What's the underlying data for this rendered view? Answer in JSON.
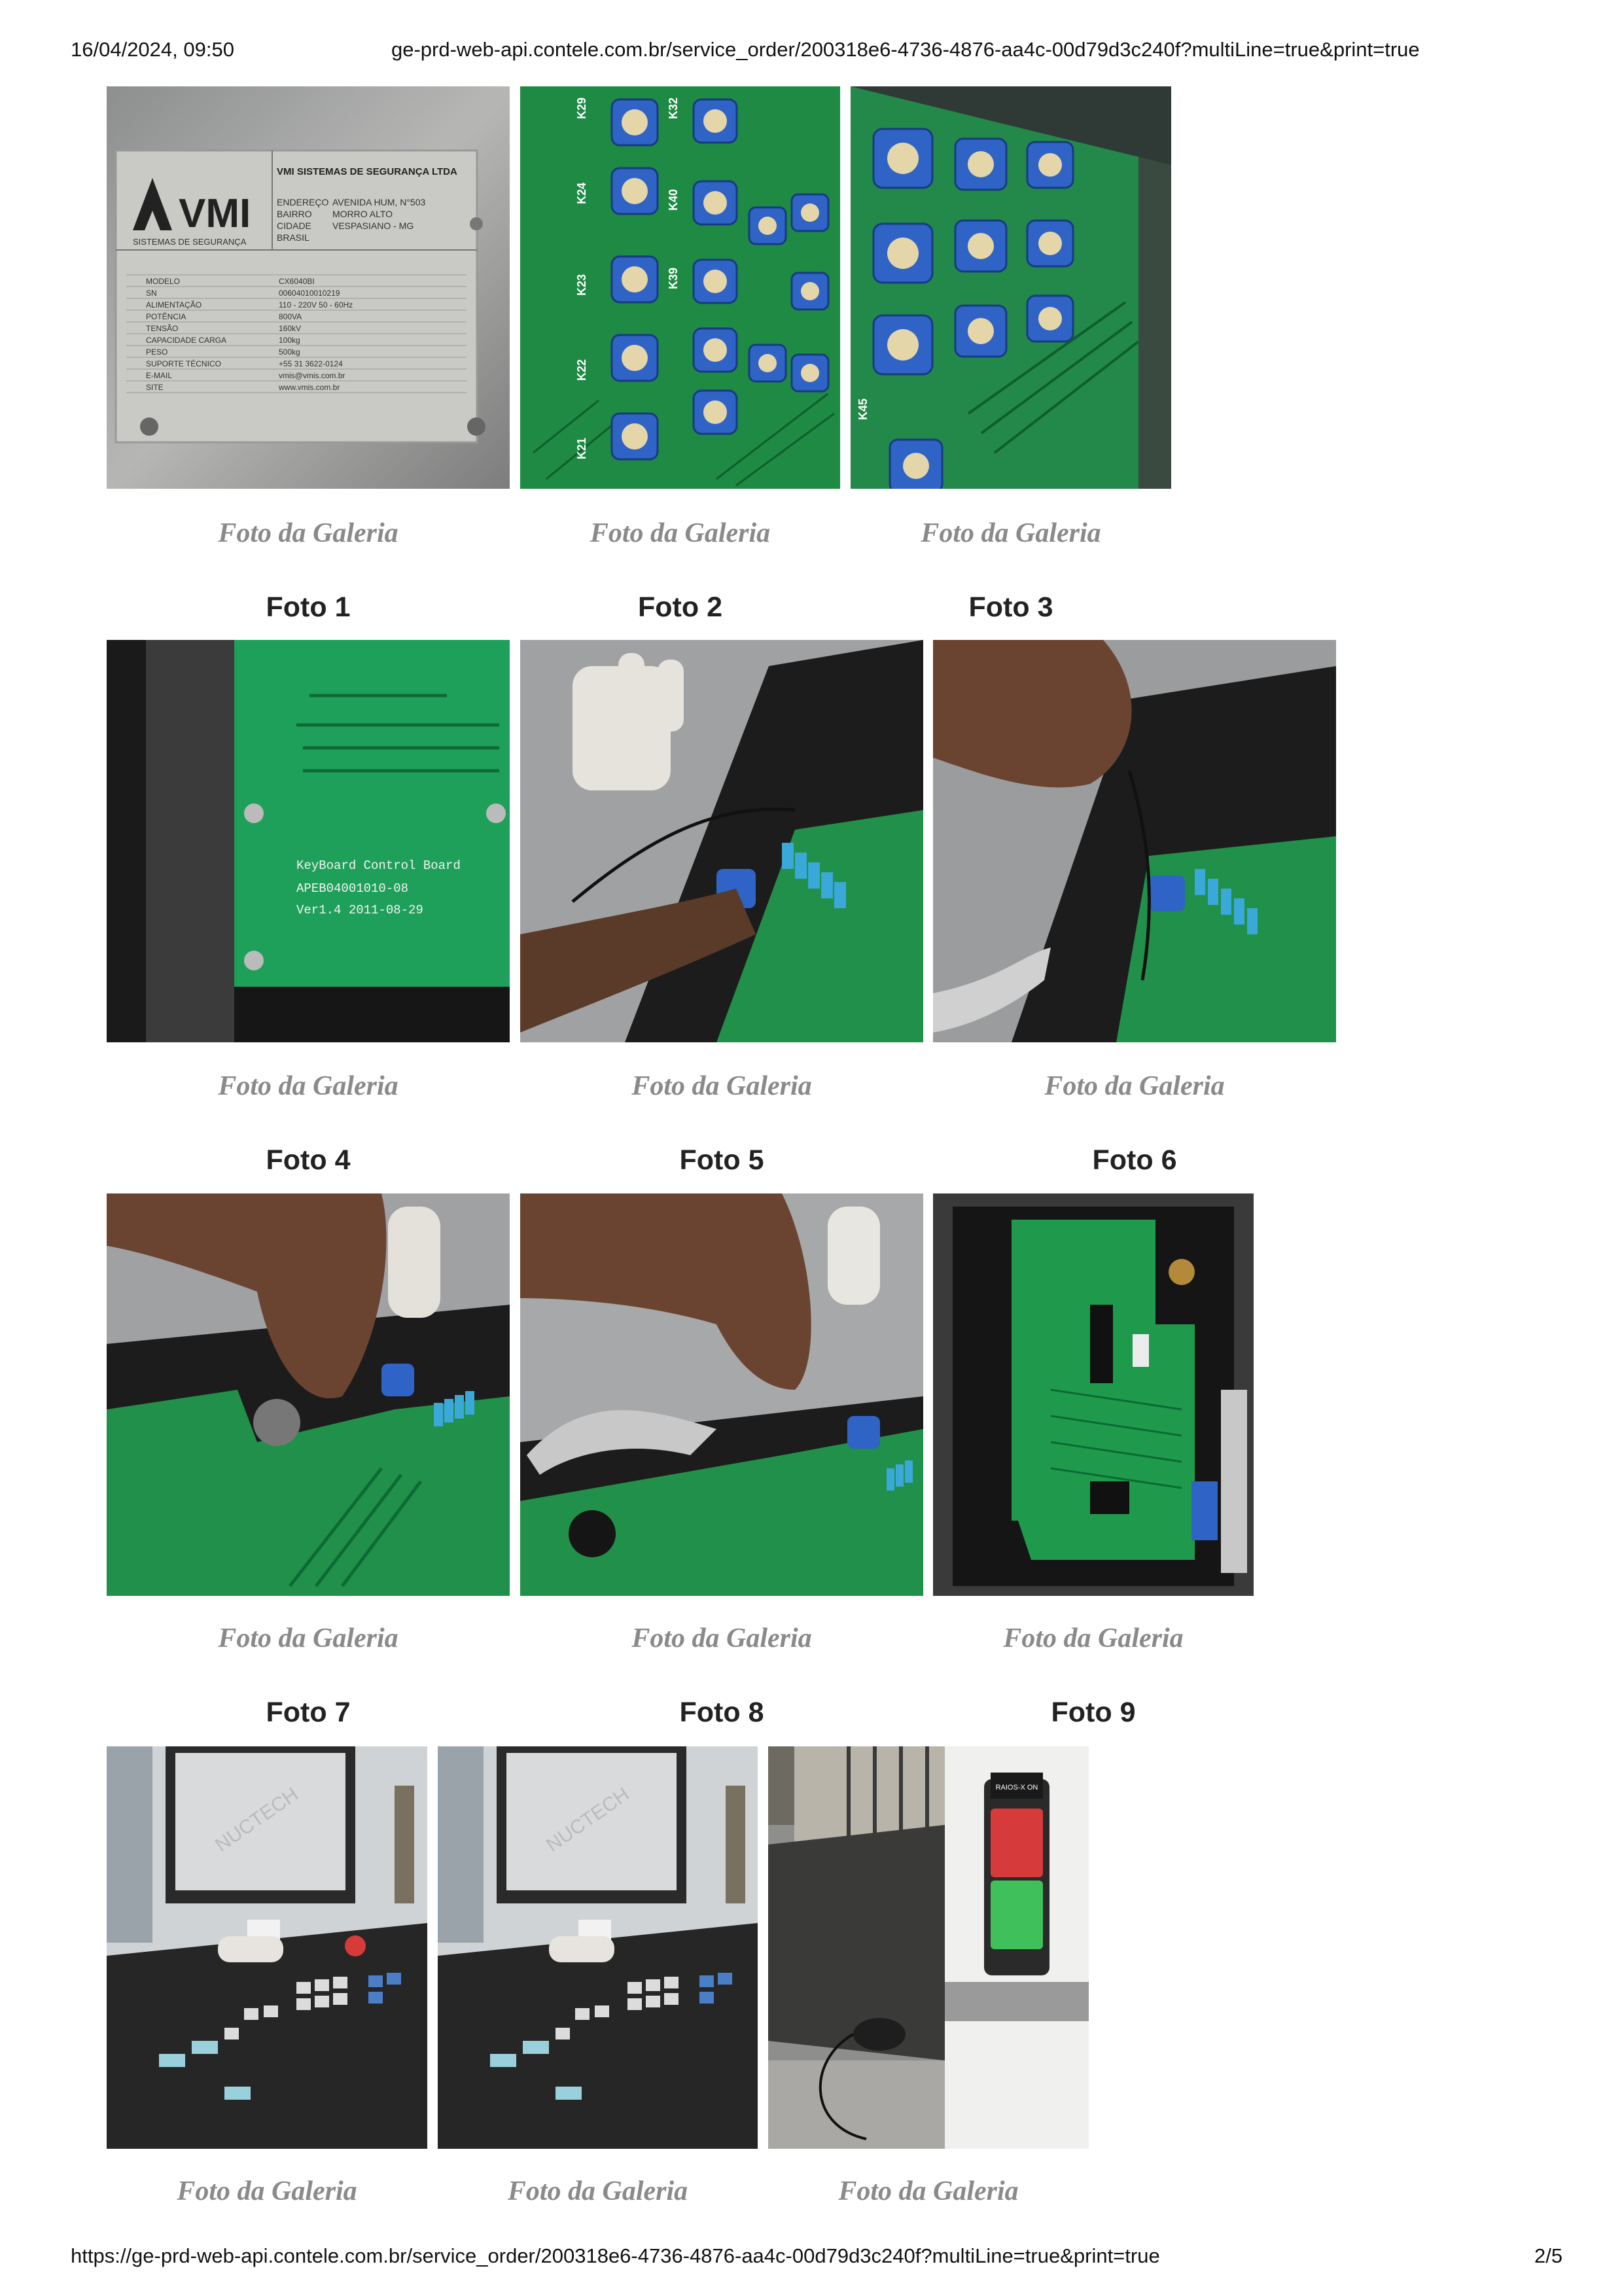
{
  "header": {
    "datetime": "16/04/2024, 09:50",
    "url": "ge-prd-web-api.contele.com.br/service_order/200318e6-4736-4876-aa4c-00d79d3c240f?multiLine=true&print=true"
  },
  "footer": {
    "url": "https://ge-prd-web-api.contele.com.br/service_order/200318e6-4736-4876-aa4c-00d79d3c240f?multiLine=true&print=true",
    "page": "2/5"
  },
  "rows": [
    {
      "captions": [
        "Foto da Galeria",
        "Foto da Galeria",
        "Foto da Galeria"
      ],
      "labels": [
        "Foto 1",
        "Foto 2",
        "Foto 3"
      ],
      "plate": {
        "company": "VMI SISTEMAS DE SEGURANÇA LTDA",
        "logo": "VMI",
        "tagline": "SISTEMAS DE SEGURANÇA",
        "address_labels": [
          "ENDEREÇO",
          "BAIRRO",
          "CIDADE"
        ],
        "address_values": [
          "AVENIDA HUM, N°503",
          "MORRO ALTO",
          "VESPASIANO - MG"
        ],
        "country": "BRASIL",
        "spec_labels": [
          "MODELO",
          "SN",
          "ALIMENTAÇÃO",
          "POTÊNCIA",
          "TENSÃO",
          "CAPACIDADE CARGA",
          "PESO",
          "SUPORTE TÉCNICO",
          "E-MAIL",
          "SITE"
        ],
        "spec_values": [
          "CX6040BI",
          "00604010010219",
          "110 - 220V   50 - 60Hz",
          "800VA",
          "160kV",
          "100kg",
          "500kg",
          "+55 31 3622-0124",
          "vmis@vmis.com.br",
          "www.vmis.com.br"
        ]
      },
      "keypad_labels": [
        "K29",
        "K32",
        "K24",
        "K40",
        "K23",
        "K39",
        "K22",
        "K21",
        "K45"
      ]
    },
    {
      "captions": [
        "Foto da Galeria",
        "Foto da Galeria",
        "Foto da Galeria"
      ],
      "labels": [
        "Foto 4",
        "Foto 5",
        "Foto 6"
      ],
      "board_text": [
        "KeyBoard Control Board",
        "APEB04001010-08",
        "Ver1.4   2011-08-29"
      ]
    },
    {
      "captions": [
        "Foto da Galeria",
        "Foto da Galeria",
        "Foto da Galeria"
      ],
      "labels": [
        "Foto 7",
        "Foto 8",
        "Foto 9"
      ]
    },
    {
      "captions": [
        "Foto da Galeria",
        "Foto da Galeria",
        "Foto da Galeria"
      ],
      "monitor_brand": "NUCTECH",
      "sign_text": "RAIOS-X ON"
    }
  ],
  "colors": {
    "pcb_green": "#1f9a4a",
    "caption_grey": "#8a8a8a",
    "key_blue": "#3b6fd0"
  }
}
